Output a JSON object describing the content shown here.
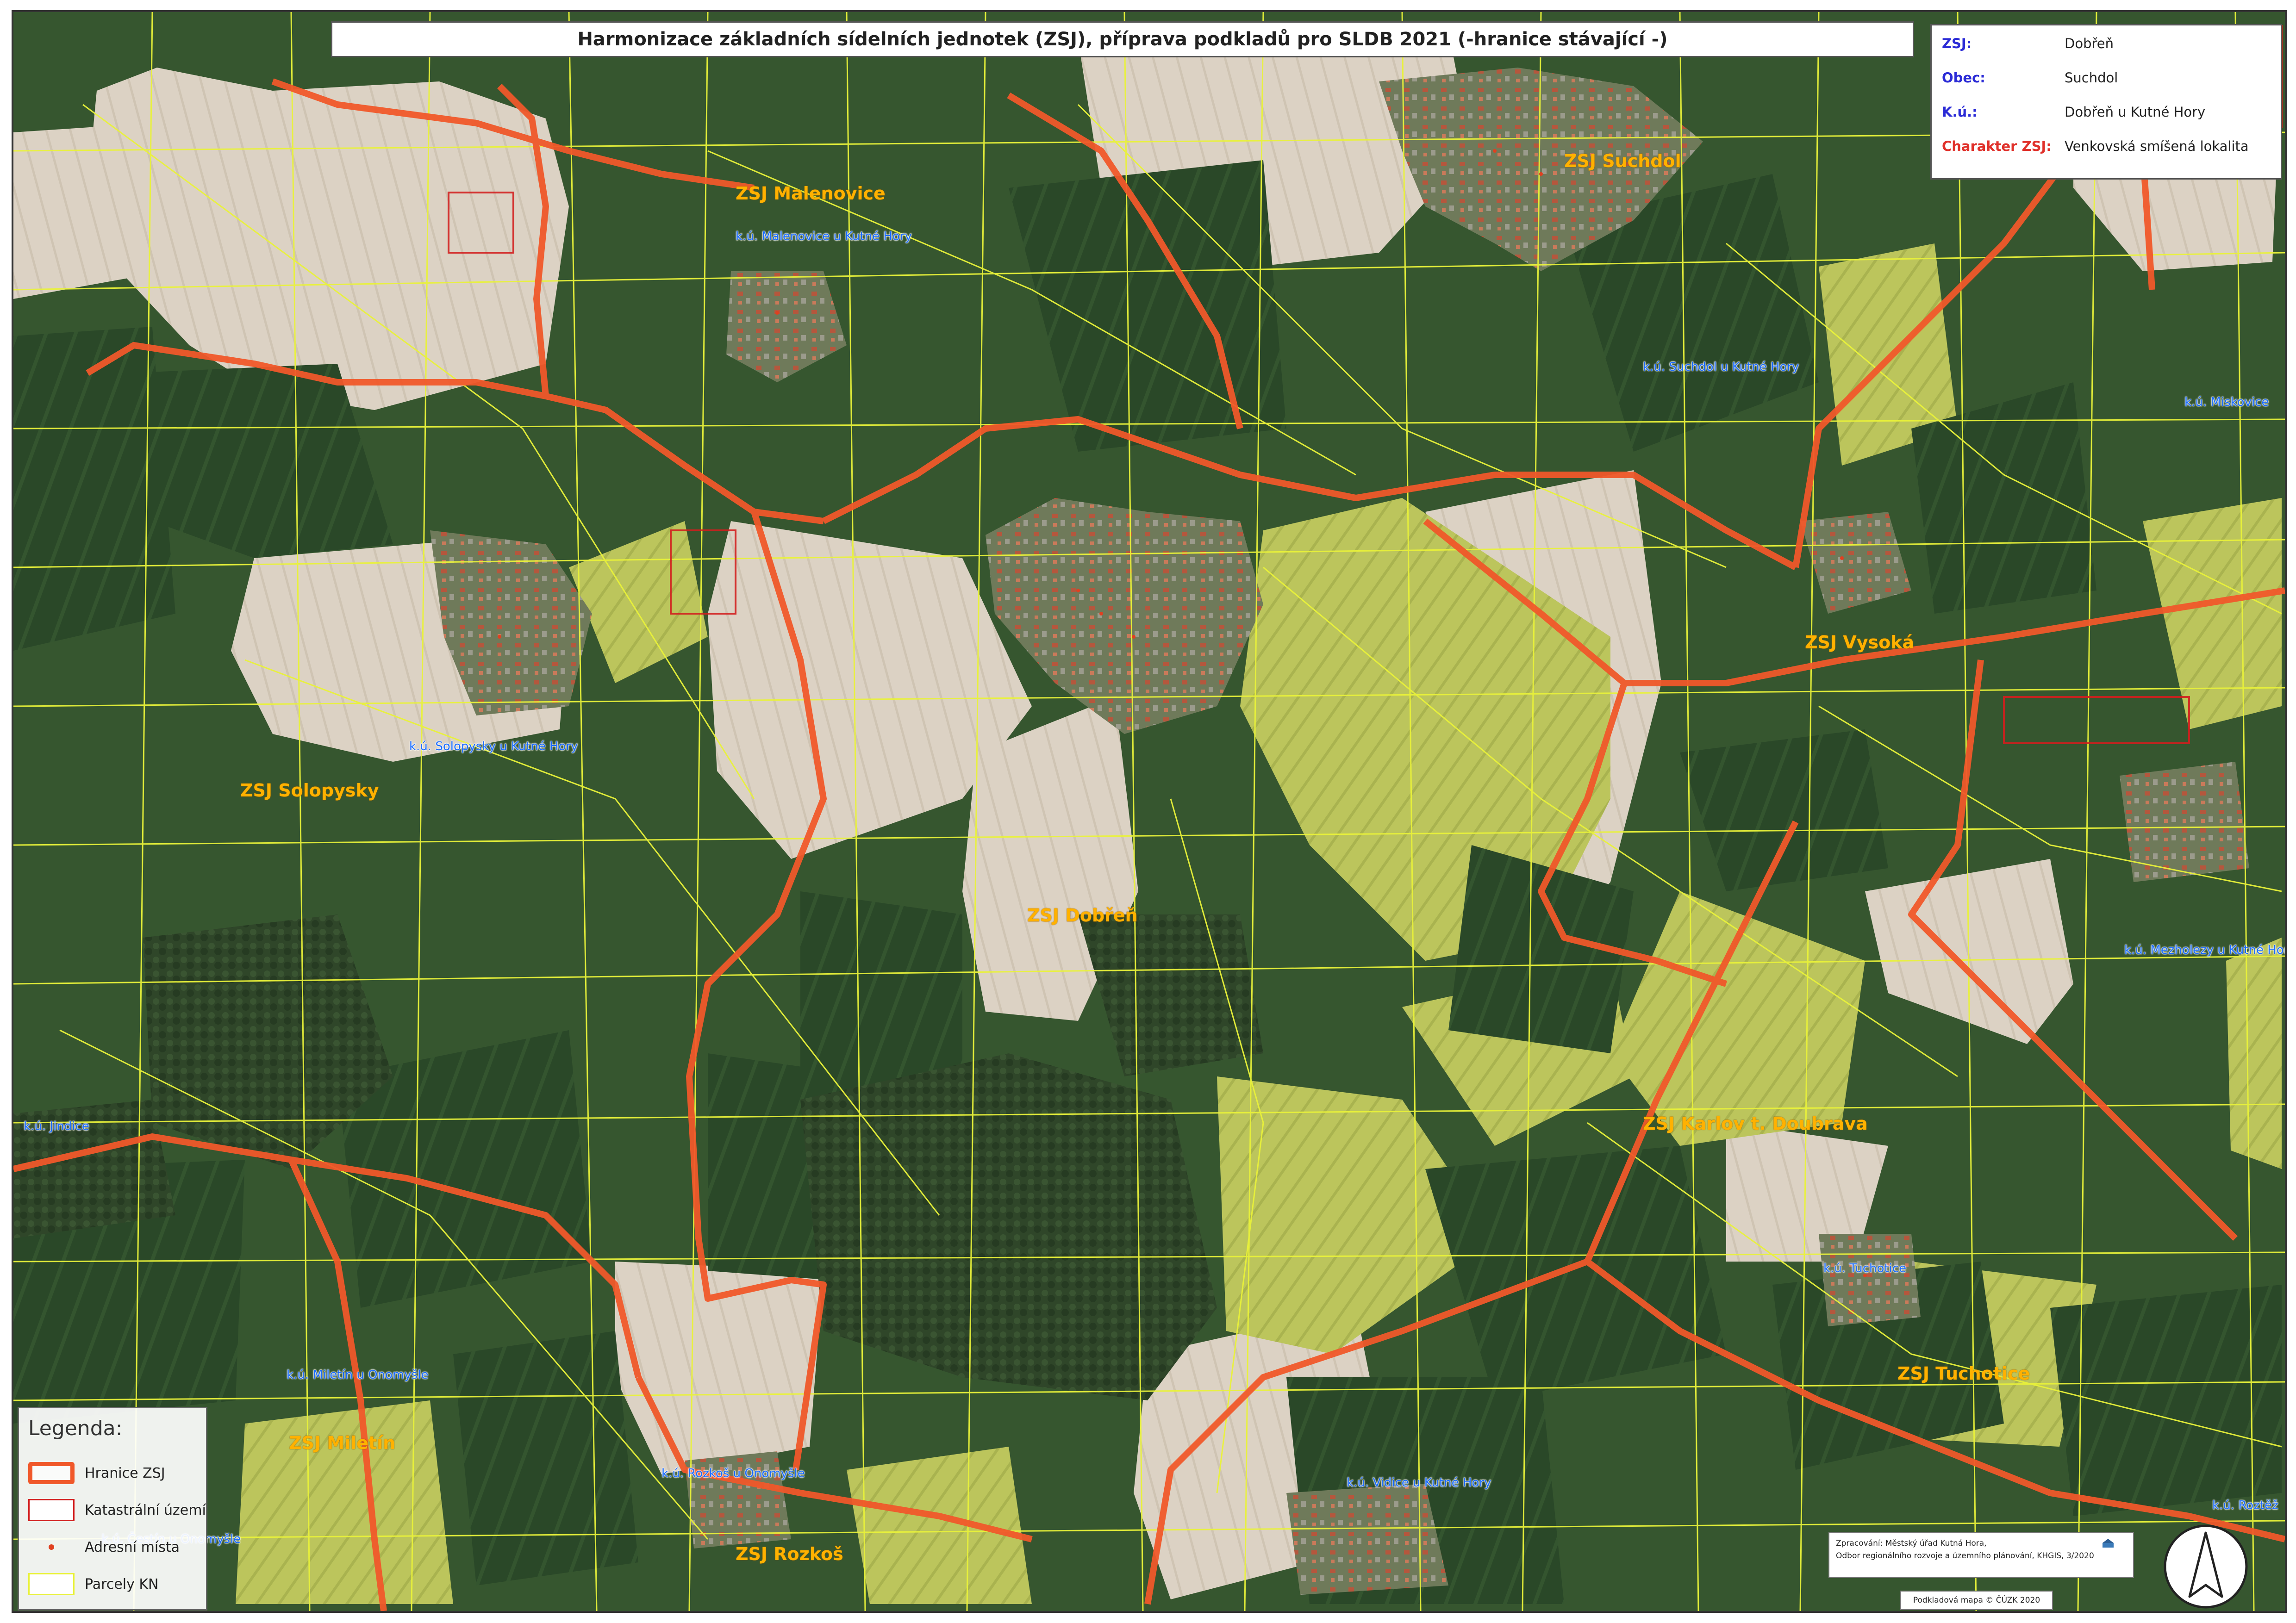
{
  "map": {
    "title": "Harmonizace základních sídelních jednotek (ZSJ), příprava podkladů pro SLDB 2021 (-hranice stávající -)",
    "info": [
      {
        "key": "ZSJ:",
        "value": "Dobřeň",
        "key_color": "#2b2bd6"
      },
      {
        "key": "Obec:",
        "value": "Suchdol",
        "key_color": "#2b2bd6"
      },
      {
        "key": "K.ú.:",
        "value": "Dobřeň u Kutné Hory",
        "key_color": "#2b2bd6"
      },
      {
        "key": "Charakter ZSJ:",
        "value": "Venkovská smíšená lokalita",
        "key_color": "#e0312b"
      }
    ],
    "zsj_labels": [
      "ZSJ Malenovice",
      "ZSJ Suchdol",
      "ZSJ Solopysky",
      "ZSJ Vysoká",
      "ZSJ Dobřeň",
      "ZSJ Karlov t. Doubrava",
      "ZSJ Tuchotice",
      "ZSJ Miletín",
      "ZSJ Rozkoš"
    ],
    "ku_labels": [
      "k.ú. Malenovice u Kutné Hory",
      "k.ú. Suchdol u Kutné Hory",
      "k.ú. Miskovice",
      "k.ú. Solopysky u Kutné Hory",
      "k.ú. Mezholezy u Kutné Hory",
      "k.ú. Jindice",
      "k.ú. Tuchotice",
      "k.ú. Miletín u Onomyšle",
      "k.ú. Rozkoš u Onomyšle",
      "k.ú. Vidice u Kutné Hory",
      "k.ú. Roztěž",
      "k.ú. Čestín u Onomyšle"
    ],
    "legend": {
      "title": "Legenda:",
      "items": [
        "Hranice ZSJ",
        "Katastrální území",
        "Adresní místa",
        "Parcely KN"
      ]
    },
    "credit_lines": [
      "Zpracování: Městský úřad Kutná Hora,",
      "Odbor regionálního rozvoje a územního plánování, KHGIS, 3/2020"
    ],
    "basemap_credit": "Podkladová mapa © ČÚZK 2020",
    "colors": {
      "zsj_boundary": "#f0582a",
      "ku_boundary": "#d21e1e",
      "parcel_lines": "#e9f23a",
      "zsj_label": "#ffb100",
      "ku_label": "#1a6cff",
      "dark_field": "#2b4a2a",
      "light_field": "#d9cfc2",
      "yellow_field": "#b9c25a",
      "forest": "#2e4428"
    }
  }
}
